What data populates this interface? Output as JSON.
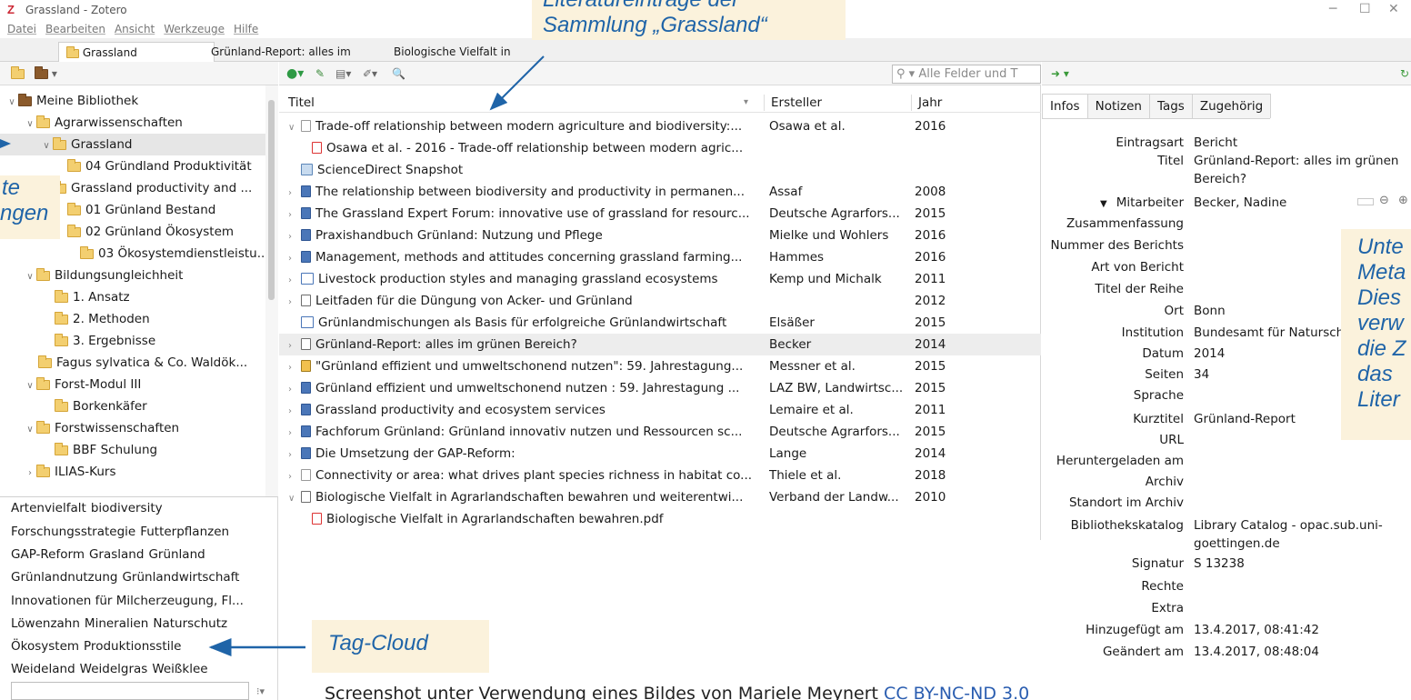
{
  "window": {
    "title": "Grassland - Zotero",
    "logo": "Z"
  },
  "menu": [
    "Datei",
    "Bearbeiten",
    "Ansicht",
    "Werkzeuge",
    "Hilfe"
  ],
  "tabs": [
    {
      "label": "Grassland"
    },
    {
      "label": "Grünland-Report: alles im g...",
      "close": "×"
    },
    {
      "label": "Biologische Vielfalt in Agra...",
      "close": "×"
    }
  ],
  "search": {
    "placeholder": "▾ Alle Felder und T"
  },
  "tree": [
    {
      "label": "Meine Bibliothek"
    },
    {
      "label": "Agrarwissenschaften"
    },
    {
      "label": "Grassland"
    },
    {
      "label": "04 Gründland Produktivität"
    },
    {
      "label": "Grassland productivity and ..."
    },
    {
      "label": "01 Grünland Bestand"
    },
    {
      "label": "02 Grünland Ökosystem"
    },
    {
      "label": "03 Ökosystemdienstleistu..."
    },
    {
      "label": "Bildungsungleichheit"
    },
    {
      "label": "1. Ansatz"
    },
    {
      "label": "2. Methoden"
    },
    {
      "label": "3. Ergebnisse"
    },
    {
      "label": "Fagus sylvatica & Co. Waldök..."
    },
    {
      "label": "Forst-Modul III"
    },
    {
      "label": "Borkenkäfer"
    },
    {
      "label": "Forstwissenschaften"
    },
    {
      "label": "BBF Schulung"
    },
    {
      "label": "ILIAS-Kurs"
    }
  ],
  "tags": [
    [
      "Artenvielfalt",
      "biodiversity"
    ],
    [
      "Forschungsstrategie",
      "Futterpflanzen"
    ],
    [
      "GAP-Reform",
      "Grasland",
      "Grünland"
    ],
    [
      "Grünlandnutzung",
      "Grünlandwirtschaft"
    ],
    [
      "Innovationen für Milcherzeugung, Fl..."
    ],
    [
      "Löwenzahn",
      "Mineralien",
      "Naturschutz"
    ],
    [
      "Ökosystem",
      "Produktionsstile"
    ],
    [
      "Weideland",
      "Weidelgras",
      "Weißklee"
    ]
  ],
  "columns": {
    "title": "Titel",
    "creator": "Ersteller",
    "year": "Jahr"
  },
  "items": [
    {
      "title": "Trade-off relationship between modern agriculture and biodiversity:...",
      "creator": "Osawa et al.",
      "year": "2016"
    },
    {
      "title": "Osawa et al. - 2016 - Trade-off relationship between modern agric...",
      "creator": "",
      "year": ""
    },
    {
      "title": "ScienceDirect Snapshot",
      "creator": "",
      "year": ""
    },
    {
      "title": "The relationship between biodiversity and productivity in permanen...",
      "creator": "Assaf",
      "year": "2008"
    },
    {
      "title": "The Grassland Expert Forum: innovative use of grassland for resourc...",
      "creator": "Deutsche Agrarfors...",
      "year": "2015"
    },
    {
      "title": "Praxishandbuch Grünland: Nutzung und Pflege",
      "creator": "Mielke und Wohlers",
      "year": "2016"
    },
    {
      "title": "Management, methods and attitudes concerning grassland farming...",
      "creator": "Hammes",
      "year": "2016"
    },
    {
      "title": "Livestock production styles and managing grassland ecosystems",
      "creator": "Kemp und Michalk",
      "year": "2011"
    },
    {
      "title": "Leitfaden für die Düngung von Acker- und Grünland",
      "creator": "",
      "year": "2012"
    },
    {
      "title": "Grünlandmischungen als Basis für erfolgreiche Grünlandwirtschaft",
      "creator": "Elsäßer",
      "year": "2015"
    },
    {
      "title": "Grünland-Report: alles im grünen Bereich?",
      "creator": "Becker",
      "year": "2014"
    },
    {
      "title": "\"Grünland effizient und umweltschonend nutzen\": 59. Jahrestagung...",
      "creator": "Messner et al.",
      "year": "2015"
    },
    {
      "title": "Grünland effizient und umweltschonend nutzen : 59. Jahrestagung ...",
      "creator": "LAZ BW, Landwirtsc...",
      "year": "2015"
    },
    {
      "title": "Grassland productivity and ecosystem services",
      "creator": "Lemaire et al.",
      "year": "2011"
    },
    {
      "title": "Fachforum Grünland: Grünland innovativ nutzen und Ressourcen sc...",
      "creator": "Deutsche Agrarfors...",
      "year": "2015"
    },
    {
      "title": "Die Umsetzung der GAP-Reform:",
      "creator": "Lange",
      "year": "2014"
    },
    {
      "title": "Connectivity or area: what drives plant species richness in habitat co...",
      "creator": "Thiele et al.",
      "year": "2018"
    },
    {
      "title": "Biologische Vielfalt in Agrarlandschaften bewahren und weiterentwi...",
      "creator": "Verband der Landw...",
      "year": "2010"
    },
    {
      "title": "Biologische Vielfalt in Agrarlandschaften bewahren.pdf",
      "creator": "",
      "year": ""
    }
  ],
  "info_tabs": [
    "Infos",
    "Notizen",
    "Tags",
    "Zugehörig"
  ],
  "metadata": [
    {
      "label": "Eintragsart",
      "value": "Bericht"
    },
    {
      "label": "Titel",
      "value": "Grünland-Report: alles im grünen",
      "value2": "Bereich?"
    },
    {
      "label": "Mitarbeiter",
      "value": "Becker, Nadine"
    },
    {
      "label": "Zusammenfassung",
      "value": ""
    },
    {
      "label": "Nummer des Berichts",
      "value": ""
    },
    {
      "label": "Art von Bericht",
      "value": ""
    },
    {
      "label": "Titel der Reihe",
      "value": ""
    },
    {
      "label": "Ort",
      "value": "Bonn"
    },
    {
      "label": "Institution",
      "value": "Bundesamt für Naturschutz"
    },
    {
      "label": "Datum",
      "value": "2014"
    },
    {
      "label": "Seiten",
      "value": "34"
    },
    {
      "label": "Sprache",
      "value": ""
    },
    {
      "label": "Kurztitel",
      "value": "Grünland-Report"
    },
    {
      "label": "URL",
      "value": ""
    },
    {
      "label": "Heruntergeladen am",
      "value": ""
    },
    {
      "label": "Archiv",
      "value": ""
    },
    {
      "label": "Standort im Archiv",
      "value": ""
    },
    {
      "label": "Bibliothekskatalog",
      "value": "Library Catalog - opac.sub.uni-",
      "value2": "goettingen.de"
    },
    {
      "label": "Signatur",
      "value": "S 13238"
    },
    {
      "label": "Rechte",
      "value": ""
    },
    {
      "label": "Extra",
      "value": ""
    },
    {
      "label": "Hinzugefügt am",
      "value": "13.4.2017, 08:41:42"
    },
    {
      "label": "Geändert am",
      "value": "13.4.2017, 08:48:04"
    }
  ],
  "callouts": {
    "top_line1": "Literatureinträge der",
    "top_line2": "Sammlung „Grassland“",
    "left_line1": "te",
    "left_line2": "ngen",
    "right_lines": [
      "Unte",
      "Meta",
      "Dies",
      "verw",
      "die Z",
      "das ",
      "Liter"
    ],
    "tagcloud": "Tag-Cloud"
  },
  "footer": {
    "text": "Screenshot unter Verwendung eines Bildes von Mariele Meynert ",
    "link": "CC BY-NC-ND 3.0"
  },
  "colors": {
    "accent": "#1f64a8",
    "callout_bg": "#fbf2dc",
    "selection": "#e6e6e6",
    "logo": "#cc2936"
  }
}
